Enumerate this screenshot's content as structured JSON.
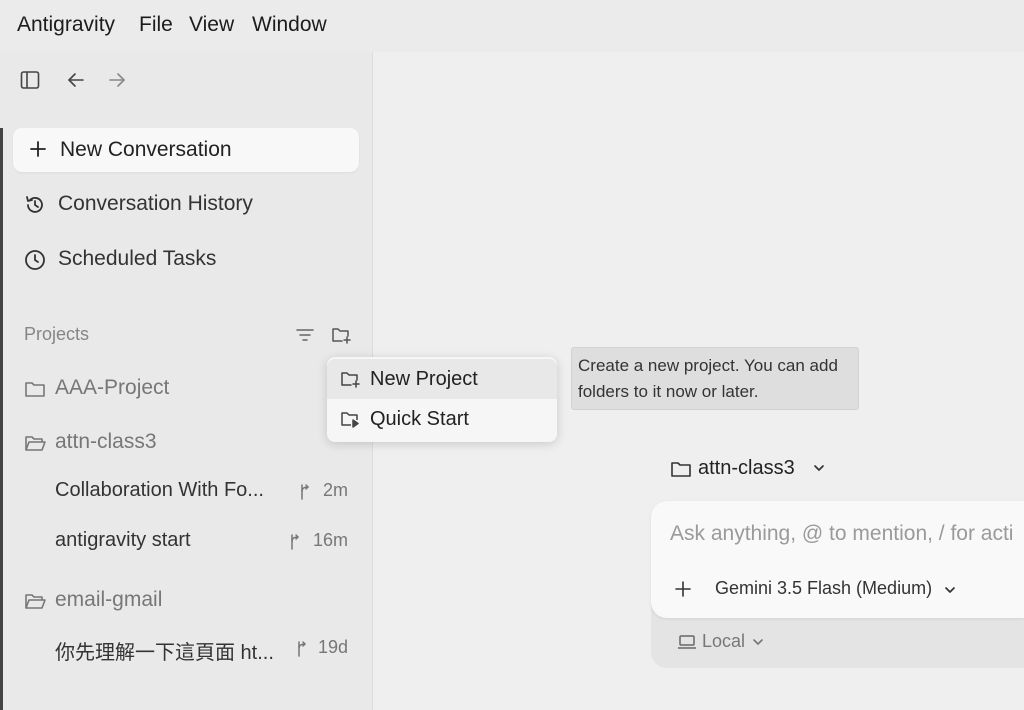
{
  "menubar": {
    "app": "Antigravity",
    "file": "File",
    "view": "View",
    "window": "Window"
  },
  "sidebar": {
    "new_conversation": "New Conversation",
    "conversation_history": "Conversation History",
    "scheduled_tasks": "Scheduled Tasks",
    "projects_header": "Projects",
    "projects": [
      {
        "name": "AAA-Project",
        "icon": "folder-icon"
      },
      {
        "name": "attn-class3",
        "icon": "folder-open-icon",
        "conversations": [
          {
            "title": "Collaboration With Fo...",
            "time": "2m"
          },
          {
            "title": "antigravity start",
            "time": "16m"
          }
        ]
      },
      {
        "name": "email-gmail",
        "icon": "folder-open-icon",
        "conversations": [
          {
            "title": "你先理解一下這頁面 ht...",
            "time": "19d"
          }
        ]
      }
    ]
  },
  "dropdown": {
    "new_project": "New Project",
    "quick_start": "Quick Start"
  },
  "tooltip": {
    "line1": "Create a new project. You can add",
    "line2": "folders to it now or later."
  },
  "main": {
    "workspace": "attn-class3",
    "composer_placeholder": "Ask anything, @ to mention, / for acti",
    "model": "Gemini 3.5 Flash (Medium)",
    "environment": "Local"
  },
  "colors": {
    "menubar_bg": "#ebebeb",
    "sidebar_bg": "#e9e9e9",
    "main_bg": "#efefef",
    "tooltip_bg": "#dedede"
  }
}
